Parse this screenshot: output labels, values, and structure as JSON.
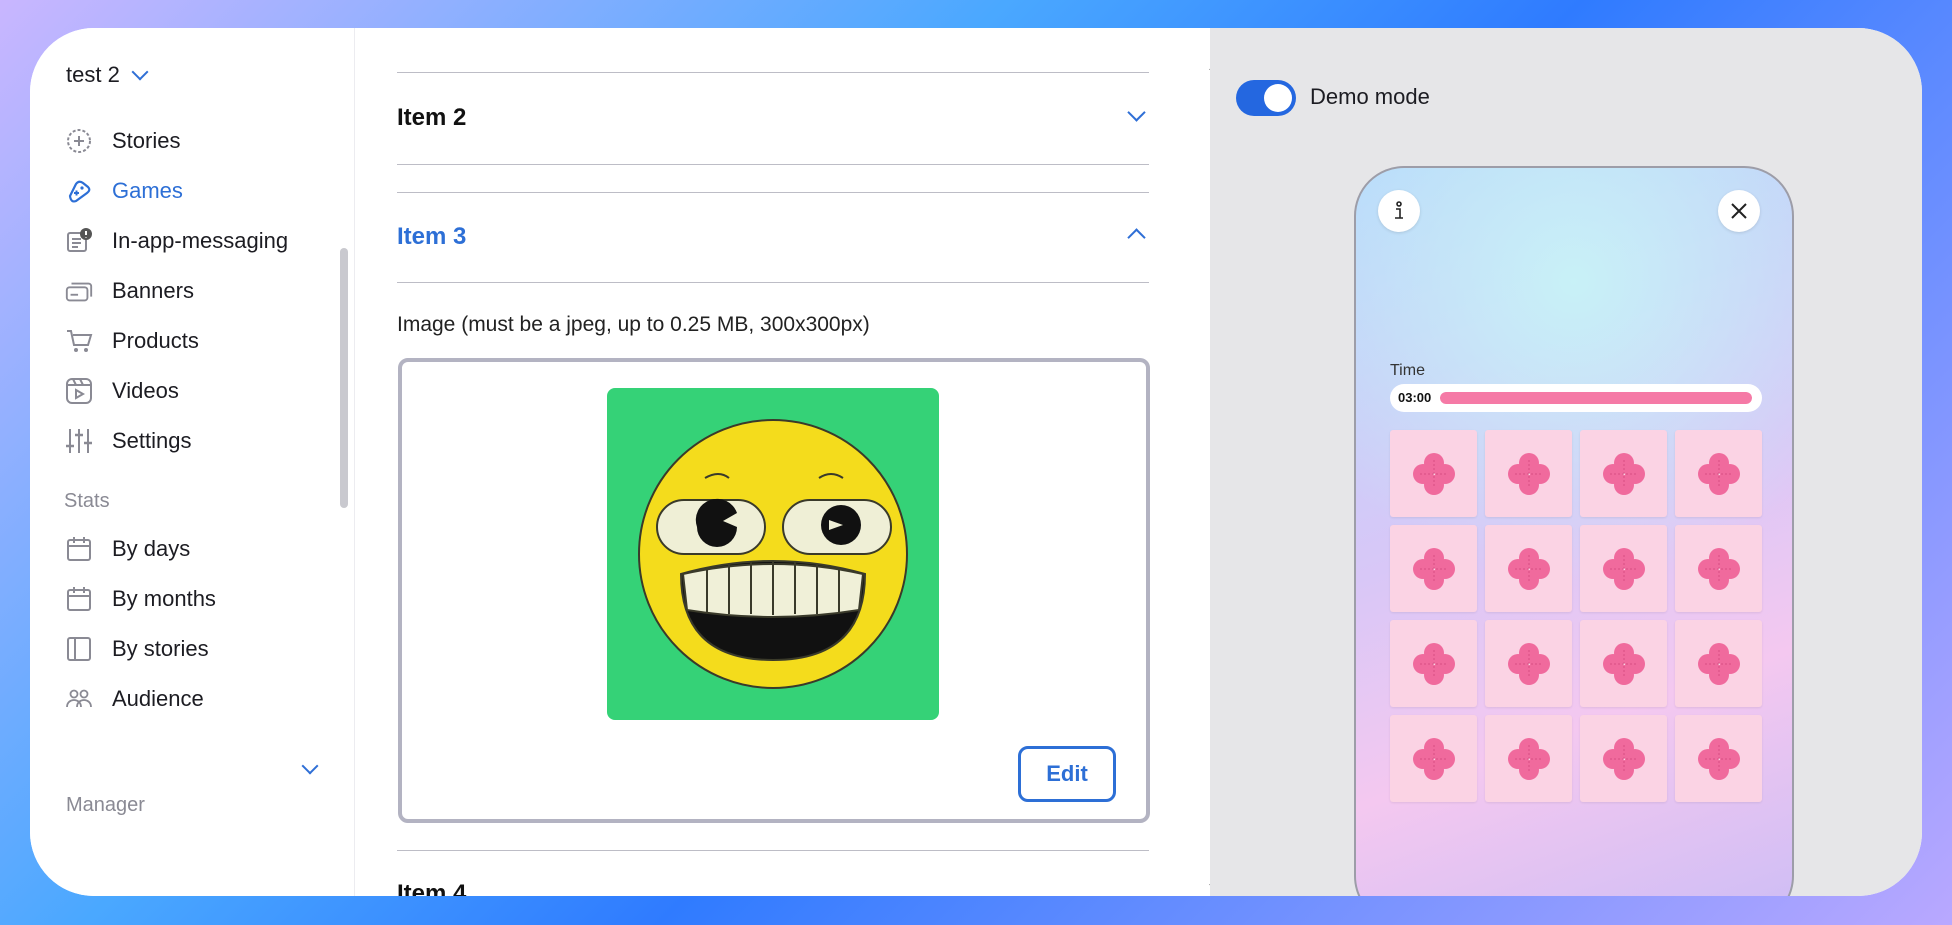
{
  "sidebar": {
    "project_name": "test 2",
    "nav_items": [
      {
        "label": "Stories",
        "icon": "plus-circle-icon",
        "active": false
      },
      {
        "label": "Games",
        "icon": "gamepad-icon",
        "active": true
      },
      {
        "label": "In-app-messaging",
        "icon": "message-alert-icon",
        "active": false
      },
      {
        "label": "Banners",
        "icon": "banners-icon",
        "active": false
      },
      {
        "label": "Products",
        "icon": "cart-icon",
        "active": false
      },
      {
        "label": "Videos",
        "icon": "video-icon",
        "active": false
      },
      {
        "label": "Settings",
        "icon": "sliders-icon",
        "active": false
      }
    ],
    "stats_label": "Stats",
    "stats_items": [
      {
        "label": "By days",
        "icon": "calendar-icon"
      },
      {
        "label": "By months",
        "icon": "calendar-icon"
      },
      {
        "label": "By stories",
        "icon": "panel-icon"
      },
      {
        "label": "Audience",
        "icon": "people-icon"
      }
    ],
    "manager_label": "Manager"
  },
  "content": {
    "items": [
      {
        "label": "Item 2",
        "expanded": false
      },
      {
        "label": "Item 3",
        "expanded": true
      },
      {
        "label": "Item 4",
        "expanded": false
      }
    ],
    "image_label": "Image (must be a jpeg, up to 0.25 MB, 300x300px)",
    "edit_label": "Edit"
  },
  "preview": {
    "demo_mode_label": "Demo mode",
    "demo_mode_on": true,
    "time_label": "Time",
    "time_value": "03:00",
    "time_progress": 1.0,
    "card_icon": "pink-clover-icon",
    "card_count": 16
  },
  "colors": {
    "accent": "#2d6fd6",
    "toggle": "#2467e0",
    "card_bg": "#fbd3e4",
    "clover": "#f06a9d",
    "timer_fill": "#f57aa6",
    "preview_bg": "#35d277"
  }
}
